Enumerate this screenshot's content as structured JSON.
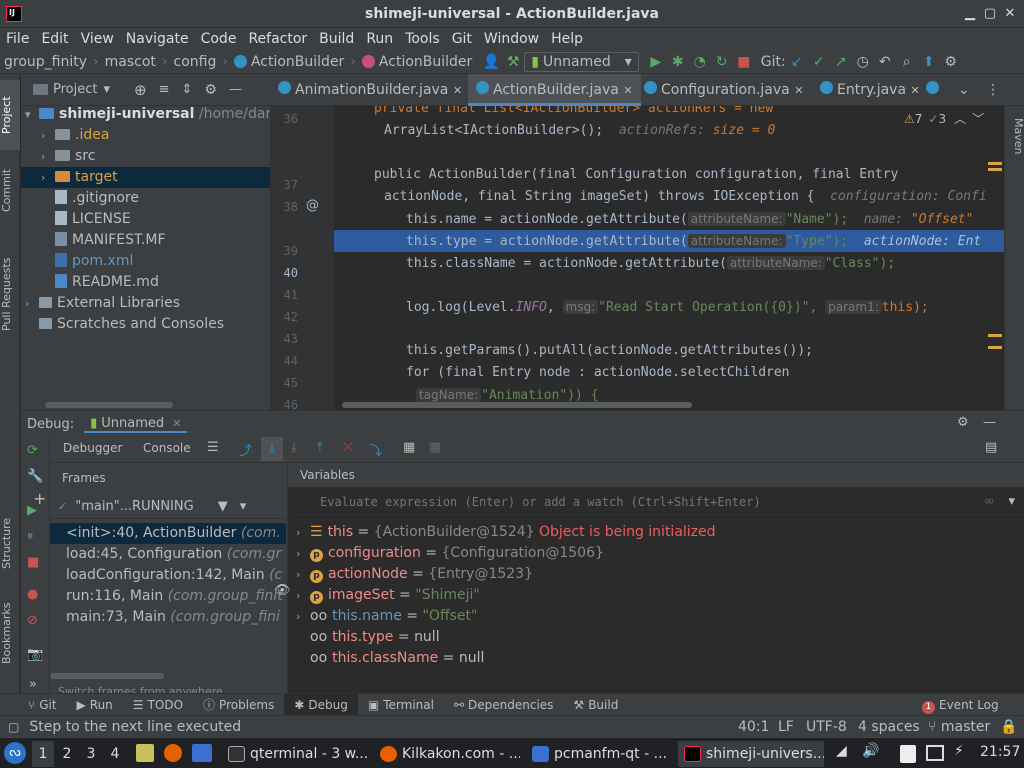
{
  "window": {
    "title": "shimeji-universal - ActionBuilder.java"
  },
  "menu": [
    "File",
    "Edit",
    "View",
    "Navigate",
    "Code",
    "Refactor",
    "Build",
    "Run",
    "Tools",
    "Git",
    "Window",
    "Help"
  ],
  "breadcrumbs": [
    "group_finity",
    "mascot",
    "config",
    "ActionBuilder",
    "ActionBuilder"
  ],
  "run_config": "Unnamed",
  "git_label": "Git:",
  "project": {
    "header": "Project",
    "items": [
      {
        "label": "shimeji-universal",
        "suffix": "/home/dartz",
        "bold": true
      },
      {
        "label": ".idea"
      },
      {
        "label": "src"
      },
      {
        "label": "target"
      },
      {
        "label": ".gitignore"
      },
      {
        "label": "LICENSE"
      },
      {
        "label": "MANIFEST.MF"
      },
      {
        "label": "pom.xml"
      },
      {
        "label": "README.md"
      },
      {
        "label": "External Libraries"
      },
      {
        "label": "Scratches and Consoles"
      }
    ]
  },
  "left_tools": [
    "Project",
    "Commit",
    "Pull Requests",
    "Structure",
    "Bookmarks"
  ],
  "right_tools": [
    "Maven"
  ],
  "tabs": [
    "AnimationBuilder.java",
    "ActionBuilder.java",
    "Configuration.java",
    "Entry.java"
  ],
  "inspections": {
    "warnings": "7",
    "ok": "3"
  },
  "line_numbers": [
    "36",
    "37",
    "38",
    "39",
    "40",
    "41",
    "42",
    "43",
    "44",
    "45",
    "46"
  ],
  "code": {
    "l36a": "private final List<IActionBuilder> actionRefs = new",
    "l36b": "ArrayList<IActionBuilder>();",
    "l36hint": "actionRefs:",
    "l36val": "size = 0",
    "l38a": "public ActionBuilder(final Configuration configuration, final Entry",
    "l38b": "actionNode, final String imageSet) throws IOException {",
    "l38hint": "configuration: Confi",
    "l39": "this.name = actionNode.getAttribute(",
    "l39p": "attributeName:",
    "l39s": "\"Name\");",
    "l39h": "name:",
    "l39v": "\"Offset\"",
    "l40": "this.type = actionNode.getAttribute(",
    "l40p": "attributeName:",
    "l40s": "\"Type\");",
    "l40h": "actionNode: Ent",
    "l41": "this.className = actionNode.getAttribute(",
    "l41p": "attributeName:",
    "l41s": "\"Class\");",
    "l43a": "log.log(Level.",
    "l43b": "INFO",
    "l43p": "msg:",
    "l43s": "\"Read Start Operation({0})\",",
    "l43p2": "param1:",
    "l43e": "this);",
    "l45": "this.getParams().putAll(actionNode.getAttributes());",
    "l46a": "for (final Entry node : actionNode.selectChildren",
    "l46p": "tagName:",
    "l46b": "\"Animation\")) {"
  },
  "debug": {
    "label": "Debug:",
    "session": "Unnamed",
    "tab_debugger": "Debugger",
    "tab_console": "Console",
    "frames_title": "Frames",
    "variables_title": "Variables",
    "thread": "\"main\"...RUNNING",
    "frames": [
      {
        "m": "<init>:40, ActionBuilder",
        "p": "(com."
      },
      {
        "m": "load:45, Configuration",
        "p": "(com.gr"
      },
      {
        "m": "loadConfiguration:142, Main",
        "p": "(c"
      },
      {
        "m": "run:116, Main",
        "p": "(com.group_finit"
      },
      {
        "m": "main:73, Main",
        "p": "(com.group_fini"
      }
    ],
    "frames_hint": "Switch frames from anywhere ...",
    "eval_placeholder": "Evaluate expression (Enter) or add a watch (Ctrl+Shift+Enter)",
    "vars": [
      {
        "name": "this",
        "val": "{ActionBuilder@1524}",
        "extra": "Object is being initialized"
      },
      {
        "name": "configuration",
        "val": "{Configuration@1506}"
      },
      {
        "name": "actionNode",
        "val": "{Entry@1523}"
      },
      {
        "name": "imageSet",
        "val": "\"Shimeji\""
      },
      {
        "name": "this.name",
        "val": "\"Offset\""
      },
      {
        "name": "this.type",
        "val": "null"
      },
      {
        "name": "this.className",
        "val": "null"
      }
    ]
  },
  "bottom_tabs": [
    "Git",
    "Run",
    "TODO",
    "Problems",
    "Debug",
    "Terminal",
    "Dependencies",
    "Build"
  ],
  "event_log": {
    "count": "1",
    "label": "Event Log"
  },
  "status": {
    "message": "Step to the next line executed",
    "pos": "40:1",
    "le": "LF",
    "enc": "UTF-8",
    "indent": "4 spaces",
    "branch": "master"
  },
  "taskbar": {
    "workspaces": [
      "1",
      "2",
      "3",
      "4"
    ],
    "windows": [
      "qterminal - 3 w...",
      "Kilkakon.com - ...",
      "pcmanfm-qt - ...",
      "shimeji-univers..."
    ],
    "clock": "21:57"
  }
}
